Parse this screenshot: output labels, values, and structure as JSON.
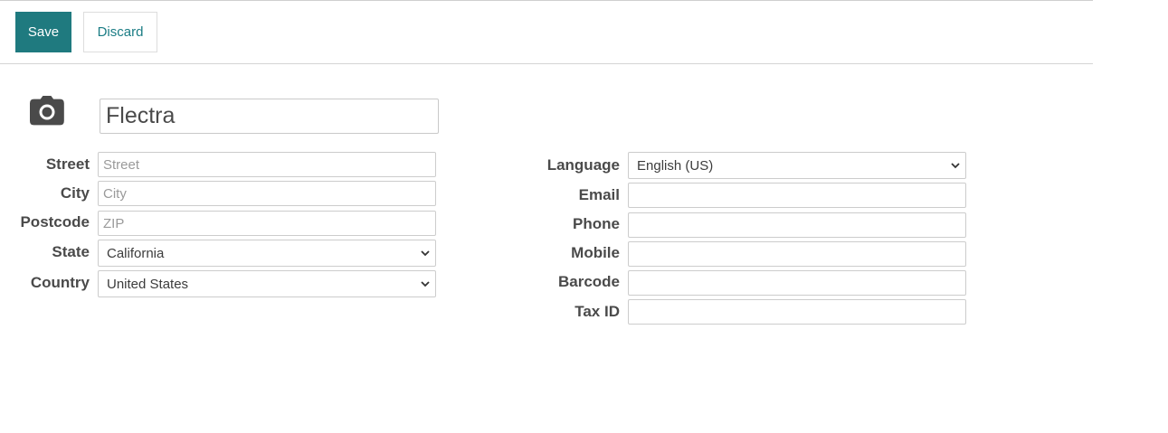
{
  "toolbar": {
    "save_label": "Save",
    "discard_label": "Discard"
  },
  "header": {
    "avatar_icon": "camera-icon",
    "name_value": "Flectra"
  },
  "address": {
    "street": {
      "label": "Street",
      "value": "",
      "placeholder": "Street"
    },
    "city": {
      "label": "City",
      "value": "",
      "placeholder": "City"
    },
    "postcode": {
      "label": "Postcode",
      "value": "",
      "placeholder": "ZIP"
    },
    "state": {
      "label": "State",
      "selected": "California"
    },
    "country": {
      "label": "Country",
      "selected": "United States"
    }
  },
  "contact": {
    "language": {
      "label": "Language",
      "selected": "English (US)"
    },
    "email": {
      "label": "Email",
      "value": ""
    },
    "phone": {
      "label": "Phone",
      "value": ""
    },
    "mobile": {
      "label": "Mobile",
      "value": ""
    },
    "barcode": {
      "label": "Barcode",
      "value": ""
    },
    "tax_id": {
      "label": "Tax ID",
      "value": ""
    }
  },
  "colors": {
    "primary": "#1f7a7f",
    "link": "#1a7c84",
    "border": "#cccccc"
  }
}
